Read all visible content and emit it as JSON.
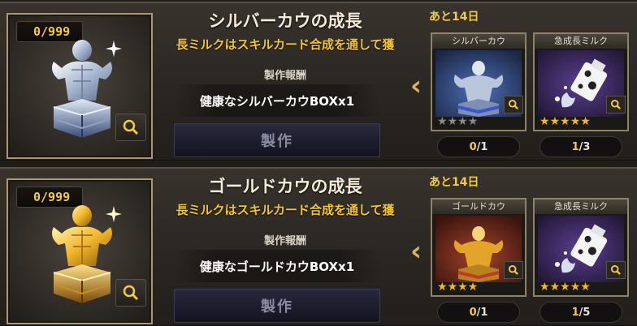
{
  "recipes": [
    {
      "counter": "0/999",
      "title": "シルバーカウの成長",
      "subtitle": "長ミルクはスキルカード合成を通して獲",
      "reward_label": "製作報酬",
      "reward": "健康なシルバーカウBOXx1",
      "craft_label": "製作",
      "days_prefix": "あと",
      "days_value": "14日",
      "materials": [
        {
          "name": "シルバーカウ",
          "stars_on": 0,
          "stars_total": 4,
          "have": "0",
          "need": "/1",
          "art": "silver-cow-figure-icon"
        },
        {
          "name": "急成長ミルク",
          "stars_on": 5,
          "stars_total": 5,
          "have": "1",
          "need": "/3",
          "art": "milk-bottle-icon"
        }
      ],
      "accent": "#c9d6ea"
    },
    {
      "counter": "0/999",
      "title": "ゴールドカウの成長",
      "subtitle": "長ミルクはスキルカード合成を通して獲",
      "reward_label": "製作報酬",
      "reward": "健康なゴールドカウBOXx1",
      "craft_label": "製作",
      "days_prefix": "あと",
      "days_value": "14日",
      "materials": [
        {
          "name": "ゴールドカウ",
          "stars_on": 4,
          "stars_total": 4,
          "have": "0",
          "need": "/1",
          "art": "gold-cow-figure-icon"
        },
        {
          "name": "急成長ミルク",
          "stars_on": 5,
          "stars_total": 5,
          "have": "1",
          "need": "/5",
          "art": "milk-bottle-icon"
        }
      ],
      "accent": "#f0b52a"
    }
  ]
}
